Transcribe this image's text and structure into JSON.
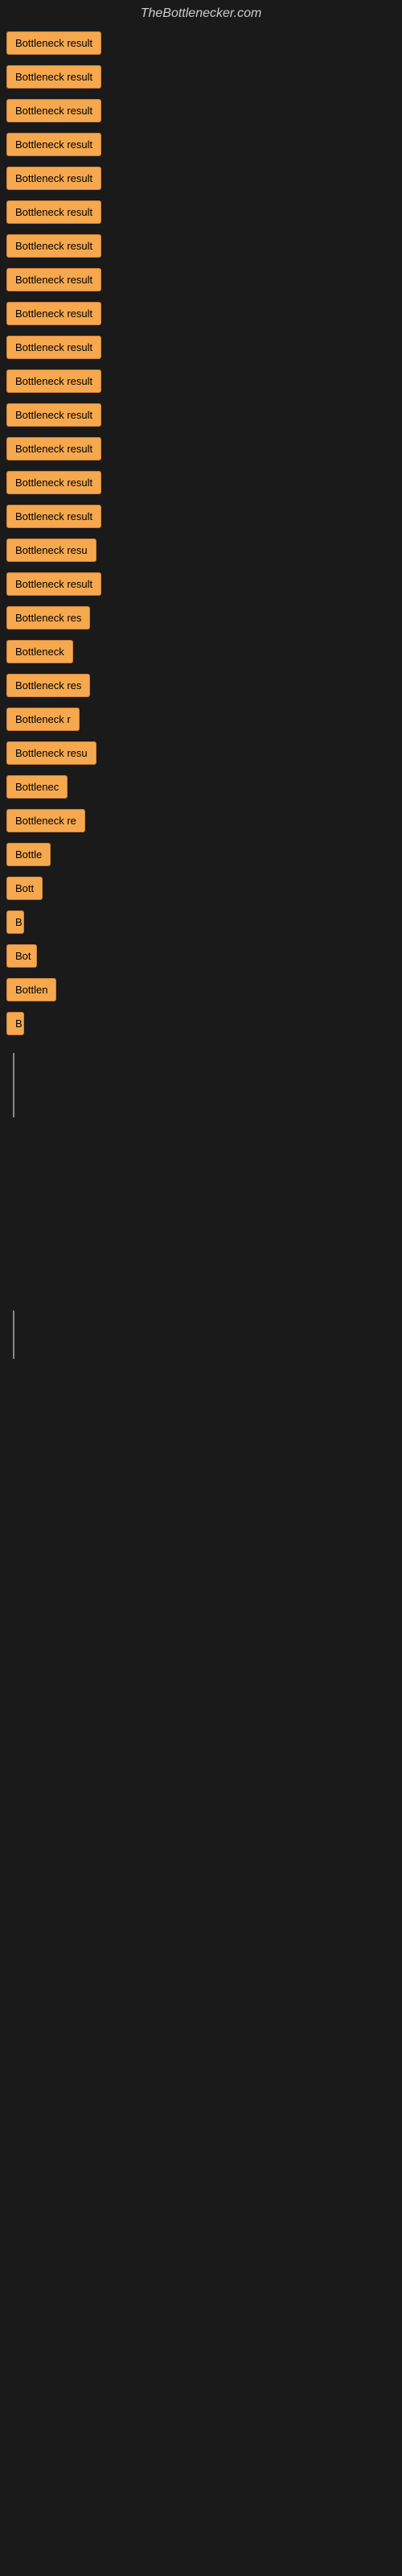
{
  "site": {
    "title": "TheBottlenecker.com"
  },
  "items": [
    {
      "label": "Bottleneck result",
      "width": 140
    },
    {
      "label": "Bottleneck result",
      "width": 140
    },
    {
      "label": "Bottleneck result",
      "width": 140
    },
    {
      "label": "Bottleneck result",
      "width": 140
    },
    {
      "label": "Bottleneck result",
      "width": 140
    },
    {
      "label": "Bottleneck result",
      "width": 140
    },
    {
      "label": "Bottleneck result",
      "width": 140
    },
    {
      "label": "Bottleneck result",
      "width": 140
    },
    {
      "label": "Bottleneck result",
      "width": 140
    },
    {
      "label": "Bottleneck result",
      "width": 140
    },
    {
      "label": "Bottleneck result",
      "width": 140
    },
    {
      "label": "Bottleneck result",
      "width": 130
    },
    {
      "label": "Bottleneck result",
      "width": 140
    },
    {
      "label": "Bottleneck result",
      "width": 140
    },
    {
      "label": "Bottleneck result",
      "width": 140
    },
    {
      "label": "Bottleneck resu",
      "width": 120
    },
    {
      "label": "Bottleneck result",
      "width": 135
    },
    {
      "label": "Bottleneck res",
      "width": 110
    },
    {
      "label": "Bottleneck",
      "width": 90
    },
    {
      "label": "Bottleneck res",
      "width": 115
    },
    {
      "label": "Bottleneck r",
      "width": 100
    },
    {
      "label": "Bottleneck resu",
      "width": 118
    },
    {
      "label": "Bottlenec",
      "width": 88
    },
    {
      "label": "Bottleneck re",
      "width": 108
    },
    {
      "label": "Bottle",
      "width": 65
    },
    {
      "label": "Bott",
      "width": 52
    },
    {
      "label": "B",
      "width": 22
    },
    {
      "label": "Bot",
      "width": 38
    },
    {
      "label": "Bottlen",
      "width": 70
    },
    {
      "label": "B",
      "width": 18
    }
  ]
}
